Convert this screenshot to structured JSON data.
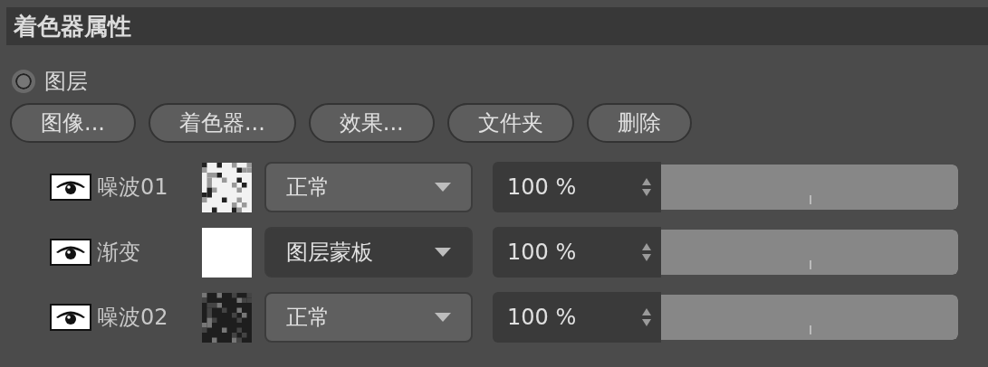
{
  "panel": {
    "title": "着色器属性"
  },
  "mode": {
    "label": "图层",
    "selected": false
  },
  "buttons": [
    "图像...",
    "着色器...",
    "效果...",
    "文件夹",
    "删除"
  ],
  "layers": [
    {
      "visible": true,
      "name": "噪波01",
      "kind": "noise-light",
      "blend": {
        "value": "正常",
        "highlighted": false
      },
      "opacity": {
        "value": "100 %",
        "level": 1
      }
    },
    {
      "visible": true,
      "name": "渐变",
      "kind": "white",
      "blend": {
        "value": "图层蒙板",
        "highlighted": true
      },
      "opacity": {
        "value": "100 %",
        "level": 1
      }
    },
    {
      "visible": true,
      "name": "噪波02",
      "kind": "noise-dark",
      "blend": {
        "value": "正常",
        "highlighted": false
      },
      "opacity": {
        "value": "100 %",
        "level": 1
      }
    }
  ]
}
